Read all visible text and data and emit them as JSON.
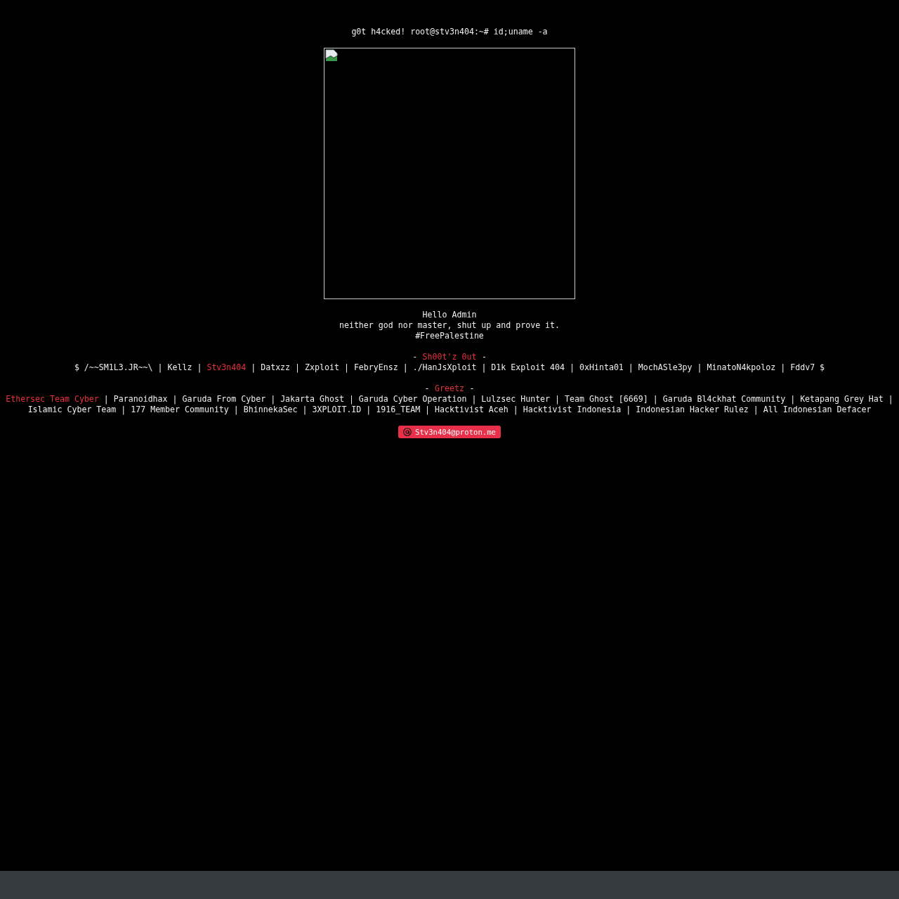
{
  "title": "g0t h4cked! root@stv3n404:~# id;uname -a",
  "image": {
    "kind": "broken"
  },
  "message": [
    "Hello Admin",
    "neither god nor master, shut up and prove it.",
    "#FreePalestine"
  ],
  "separator": "|",
  "dash": "-",
  "shoutouts": {
    "heading": "Sh00t'z 0ut",
    "prefix": "$",
    "suffix": "$",
    "names": [
      {
        "name": "/~~SM1L3.JR~~\\",
        "highlight": false
      },
      {
        "name": "Kellz",
        "highlight": false
      },
      {
        "name": "Stv3n404",
        "highlight": true
      },
      {
        "name": "Datxzz",
        "highlight": false
      },
      {
        "name": "Zxploit",
        "highlight": false
      },
      {
        "name": "FebryEnsz",
        "highlight": false
      },
      {
        "name": "./HanJsXploit",
        "highlight": false
      },
      {
        "name": "D1k Exploit 404",
        "highlight": false
      },
      {
        "name": "0xHinta01",
        "highlight": false
      },
      {
        "name": "MochASle3py",
        "highlight": false
      },
      {
        "name": "MinatoN4kpoloz",
        "highlight": false
      },
      {
        "name": "Fddv7",
        "highlight": false
      }
    ]
  },
  "greetz": {
    "heading": "Greetz",
    "names": [
      {
        "name": "Ethersec Team Cyber",
        "highlight": true
      },
      {
        "name": "Paranoidhax",
        "highlight": false
      },
      {
        "name": "Garuda From Cyber",
        "highlight": false
      },
      {
        "name": "Jakarta Ghost",
        "highlight": false
      },
      {
        "name": "Garuda Cyber Operation",
        "highlight": false
      },
      {
        "name": "Lulzsec Hunter",
        "highlight": false
      },
      {
        "name": "Team Ghost [6669]",
        "highlight": false
      },
      {
        "name": "Garuda Bl4ckhat Community",
        "highlight": false
      },
      {
        "name": "Ketapang Grey Hat",
        "highlight": false
      },
      {
        "name": "Islamic Cyber Team",
        "highlight": false
      },
      {
        "name": "177 Member Community",
        "highlight": false
      },
      {
        "name": "BhinnekaSec",
        "highlight": false
      },
      {
        "name": "3XPLOIT.ID",
        "highlight": false
      },
      {
        "name": "1916_TEAM",
        "highlight": false
      },
      {
        "name": "Hacktivist Aceh",
        "highlight": false
      },
      {
        "name": "Hacktivist Indonesia",
        "highlight": false
      },
      {
        "name": "Indonesian Hacker Rulez",
        "highlight": false
      },
      {
        "name": "All Indonesian Defacer",
        "highlight": false
      }
    ]
  },
  "contact": {
    "email": "Stv3n404@proton.me"
  }
}
